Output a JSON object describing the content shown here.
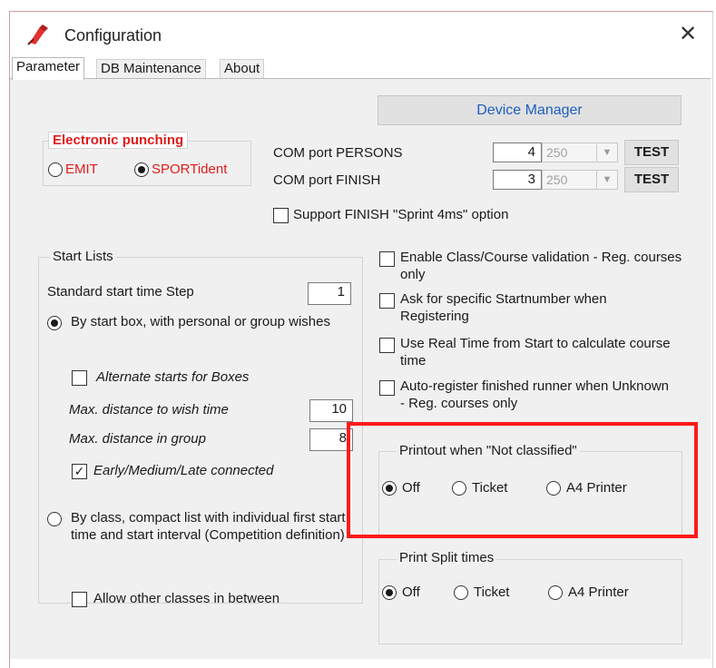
{
  "window": {
    "title": "Configuration",
    "app_icon": "pen-tool-icon",
    "close_glyph": "✕"
  },
  "tabs": [
    {
      "label": "Parameter",
      "active": true
    },
    {
      "label": "DB Maintenance",
      "active": false
    },
    {
      "label": "About",
      "active": false
    }
  ],
  "device_manager": {
    "label": "Device Manager"
  },
  "electronic_punching": {
    "title": "Electronic punching",
    "options": [
      {
        "label": "EMIT",
        "selected": false
      },
      {
        "label": "SPORTident",
        "selected": true
      }
    ]
  },
  "com_ports": [
    {
      "label": "COM port PERSONS",
      "value": "4",
      "baud": "250",
      "test_label": "TEST"
    },
    {
      "label": "COM port FINISH",
      "value": "3",
      "baud": "250",
      "test_label": "TEST"
    }
  ],
  "sprint_option": {
    "label": "Support FINISH \"Sprint 4ms\" option",
    "checked": false
  },
  "start_lists": {
    "title": "Start Lists",
    "step_label": "Standard start time Step",
    "step_value": "1",
    "by_start_box": {
      "label": "By start box, with personal or group wishes",
      "selected": true
    },
    "alternate_starts": {
      "label": "Alternate starts for Boxes",
      "checked": false
    },
    "max_wish_label": "Max. distance to wish time",
    "max_wish_value": "10",
    "max_group_label": "Max. distance in group",
    "max_group_value": "8",
    "early_medium_late": {
      "label": "Early/Medium/Late connected",
      "checked": true
    },
    "by_class": {
      "label": "By class, compact list with individual first start time and start interval (Competition definition)",
      "selected": false
    },
    "allow_other": {
      "label": "Allow other classes in between",
      "checked": false
    }
  },
  "options": [
    {
      "label": "Enable Class/Course validation - Reg. courses only",
      "checked": false
    },
    {
      "label": "Ask for specific Startnumber when Registering",
      "checked": false
    },
    {
      "label": "Use Real Time from Start to calculate course time",
      "checked": false
    },
    {
      "label": "Auto-register finished runner when Unknown - Reg. courses only",
      "checked": false
    }
  ],
  "printout_not_classified": {
    "title": "Printout when \"Not classified\"",
    "options": [
      {
        "label": "Off",
        "selected": true
      },
      {
        "label": "Ticket",
        "selected": false
      },
      {
        "label": "A4 Printer",
        "selected": false
      }
    ]
  },
  "print_split_times": {
    "title": "Print Split times",
    "options": [
      {
        "label": "Off",
        "selected": true
      },
      {
        "label": "Ticket",
        "selected": false
      },
      {
        "label": "A4 Printer",
        "selected": false
      }
    ]
  },
  "colors": {
    "accent_red": "#e01b1b",
    "link_blue": "#1f5fbf",
    "highlight": "#ff1a1a",
    "panel_bg": "#f0f0f0"
  }
}
